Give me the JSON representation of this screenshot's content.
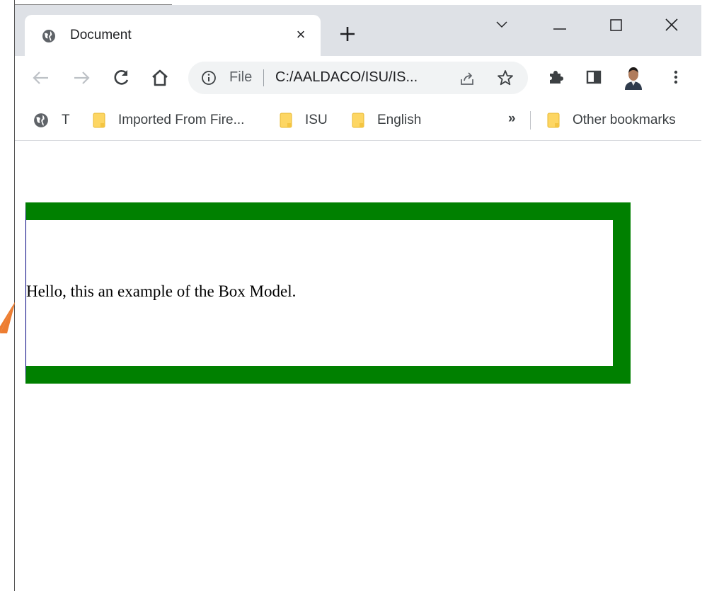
{
  "colors": {
    "tabstrip_bg": "#dee1e6",
    "box_border": "#008000",
    "box_left_border": "#000080",
    "arrow": "#ed7d31"
  },
  "tab": {
    "title": "Document",
    "favicon": "globe-icon",
    "close": "×"
  },
  "toolbar": {
    "omnibox_scheme": "File",
    "omnibox_url": "C:/AALDACO/ISU/IS..."
  },
  "bookmarks": {
    "items": [
      {
        "label": "T",
        "icon": "globe-icon"
      },
      {
        "label": "Imported From Fire...",
        "icon": "folder-icon"
      },
      {
        "label": "ISU",
        "icon": "folder-icon"
      },
      {
        "label": "English",
        "icon": "folder-icon"
      }
    ],
    "more": "»",
    "other": "Other bookmarks"
  },
  "page": {
    "box_text": "Hello, this an example of the Box Model."
  }
}
